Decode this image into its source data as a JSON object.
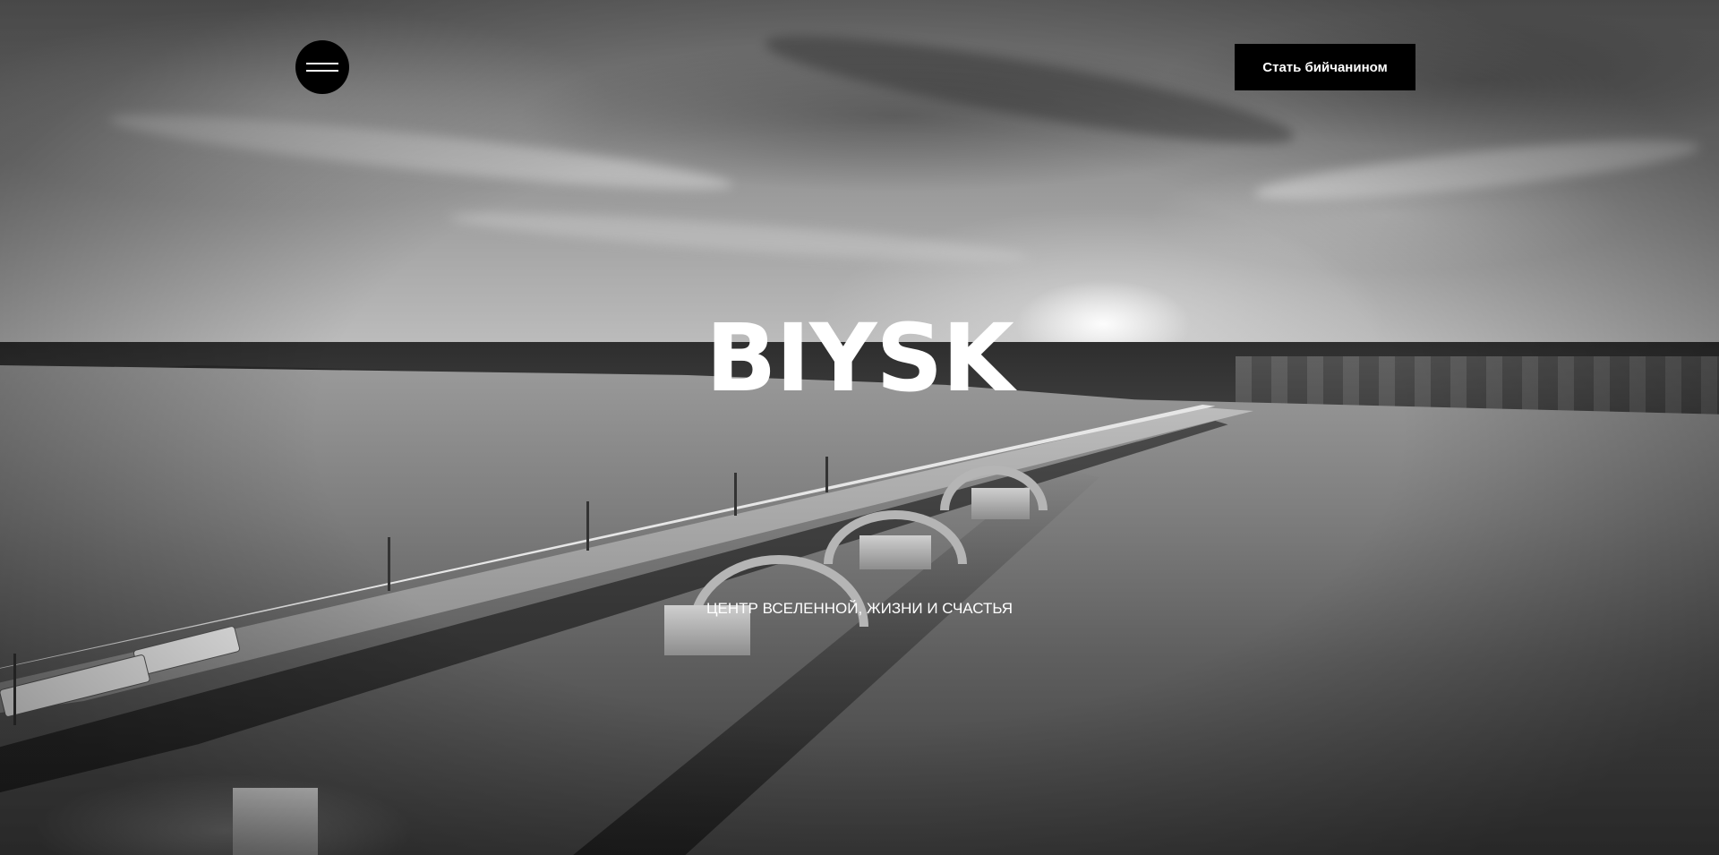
{
  "header": {
    "menu_icon": "hamburger-menu-icon",
    "cta_label": "Стать бийчанином"
  },
  "hero": {
    "title": "BIYSK",
    "subtitle": "ЦЕНТР ВСЕЛЕННОЙ, ЖИЗНИ И СЧАСТЬЯ",
    "background": "black-and-white aerial photo of a bridge over a river at sunset"
  },
  "colors": {
    "button_bg": "#000000",
    "text": "#ffffff"
  }
}
